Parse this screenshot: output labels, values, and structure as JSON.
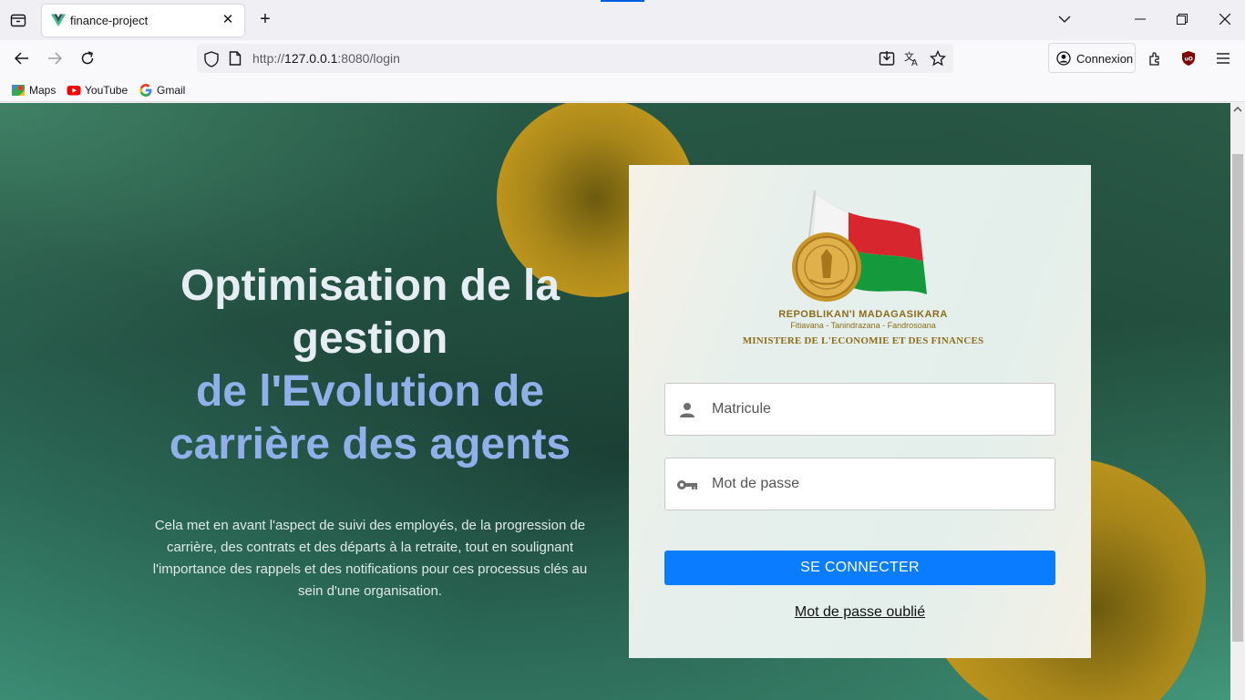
{
  "browser": {
    "tab_title": "finance-project",
    "url_prefix": "http://",
    "url_host": "127.0.0.1",
    "url_rest": ":8080/login",
    "account_button": "Connexion",
    "bookmarks": [
      "Maps",
      "YouTube",
      "Gmail"
    ]
  },
  "hero": {
    "title_line1": "Optimisation de la",
    "title_line2": "gestion",
    "title_line3": "de l'Evolution de",
    "title_line4": "carrière des agents",
    "description": "Cela met en avant l'aspect de suivi des employés, de la progression de carrière, des contrats et des départs à la retraite, tout en soulignant l'importance des rappels et des notifications pour ces processus clés au sein d'une organisation."
  },
  "logo": {
    "line1": "REPOBLIKAN'I MADAGASIKARA",
    "line2": "Fitiavana - Tanindrazana - Fandrosoana",
    "line3": "MINISTERE DE L'ECONOMIE ET DES FINANCES"
  },
  "login": {
    "matricule_placeholder": "Matricule",
    "password_placeholder": "Mot de passe",
    "submit_label": "SE CONNECTER",
    "forgot_label": "Mot de passe oublié"
  },
  "colors": {
    "accent": "#0a7cff",
    "gold": "#c49a1e",
    "hero_accent_text": "#8fb0e8"
  }
}
